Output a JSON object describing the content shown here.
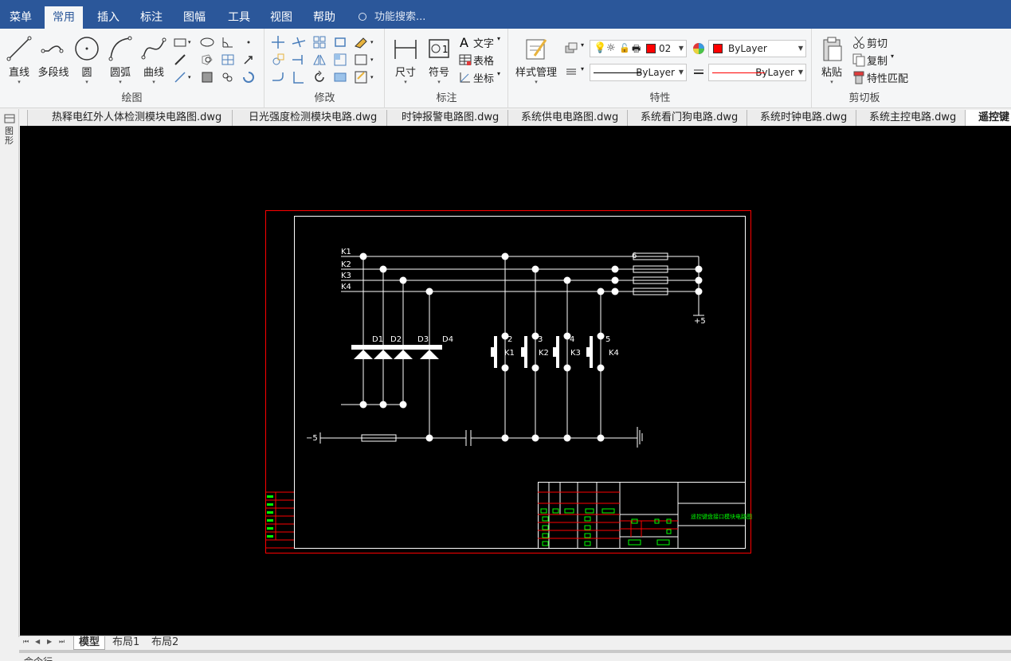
{
  "menu": {
    "items": [
      "菜单",
      "常用",
      "插入",
      "标注",
      "图幅",
      "工具",
      "视图",
      "帮助"
    ],
    "active_index": 1,
    "search_placeholder": "功能搜索..."
  },
  "ribbon": {
    "draw": {
      "label": "绘图",
      "line": "直线",
      "polyline": "多段线",
      "circle": "圆",
      "arc": "圆弧",
      "curve": "曲线"
    },
    "modify": {
      "label": "修改"
    },
    "annotate": {
      "label": "标注",
      "dimension": "尺寸",
      "symbol": "符号",
      "text": "文字",
      "table": "表格",
      "coord": "坐标"
    },
    "properties": {
      "label": "特性",
      "style_mgr": "样式管理",
      "layer_value": "02",
      "color_value": "ByLayer",
      "linetype_value": "ByLayer",
      "lineweight_value": "ByLayer",
      "layer_color": "#ff0000",
      "color_swatch": "#ff0000"
    },
    "clipboard": {
      "label": "剪切板",
      "paste": "粘贴",
      "cut": "剪切",
      "copy": "复制",
      "match": "特性匹配"
    }
  },
  "doc_tabs": [
    "热释电红外人体检测模块电路图.dwg",
    "日光强度检测模块电路.dwg",
    "时钟报警电路图.dwg",
    "系统供电电路图.dwg",
    "系统看门狗电路.dwg",
    "系统时钟电路.dwg",
    "系统主控电路.dwg",
    "遥控键"
  ],
  "side_strip": "图形",
  "layout_tabs": [
    "模型",
    "布局1",
    "布局2"
  ],
  "command_line": "命令行",
  "drawing": {
    "bus_labels": [
      "K1",
      "K2",
      "K3",
      "K4"
    ],
    "diode_labels": [
      "D1",
      "D2",
      "D3",
      "D4"
    ],
    "switch_labels": [
      "K1",
      "K2",
      "K3",
      "K4"
    ],
    "switch_numbers": [
      "2",
      "3",
      "4",
      "5"
    ],
    "plus_label": "+5",
    "minus_label": "−5",
    "pin_top": "6",
    "title_block_text": "遥控键盘接口模块电路图",
    "border_color": "#ff0000",
    "line_color": "#ffffff",
    "green_color": "#00ff00"
  }
}
